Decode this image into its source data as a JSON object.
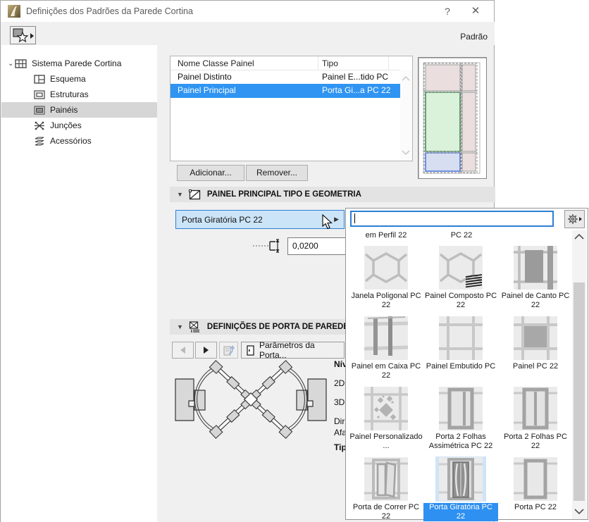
{
  "window": {
    "title": "Definições dos Padrões da Parede Cortina",
    "help": "?",
    "close": "✕"
  },
  "toolbar": {
    "preset_label": "Padrão",
    "favorites_icon": "square-star-flyout-icon"
  },
  "sidebar": {
    "items": [
      {
        "label": "Sistema Parede Cortina",
        "icon": "curtain-wall-system-icon",
        "level": 0,
        "expanded": true,
        "selected": false
      },
      {
        "label": "Esquema",
        "icon": "scheme-icon",
        "level": 1,
        "selected": false
      },
      {
        "label": "Estruturas",
        "icon": "frames-icon",
        "level": 1,
        "selected": false
      },
      {
        "label": "Painéis",
        "icon": "panel-icon",
        "level": 1,
        "selected": true
      },
      {
        "label": "Junções",
        "icon": "junction-icon",
        "level": 1,
        "selected": false
      },
      {
        "label": "Acessórios",
        "icon": "accessories-icon",
        "level": 1,
        "selected": false
      }
    ]
  },
  "panel_table": {
    "columns": [
      "Nome Classe Painel",
      "Tipo"
    ],
    "rows": [
      {
        "name": "Painel Distinto",
        "type": "Painel E...tido PC",
        "selected": false
      },
      {
        "name": "Painel Principal",
        "type": "Porta Gi...a PC 22",
        "selected": true
      }
    ],
    "add_label": "Adicionar...",
    "remove_label": "Remover..."
  },
  "section1": {
    "title": "PAINEL PRINCIPAL TIPO E GEOMETRIA"
  },
  "type_dropdown": {
    "value": "Porta Giratória PC 22"
  },
  "thickness": {
    "value": "0,0200",
    "icon": "panel-thickness-icon"
  },
  "section2": {
    "title": "DEFINIÇÕES DE PORTA DE PAREDE CO"
  },
  "door_toolbar": {
    "back_icon": "arrow-left-icon",
    "forward_icon": "arrow-right-icon",
    "transfer_icon": "transfer-settings-icon",
    "params_label": "Parâmetros da Porta..."
  },
  "door_params": {
    "labels": [
      {
        "text": "Nív",
        "bold": true
      },
      {
        "text": "2D",
        "bold": false
      },
      {
        "text": "3D",
        "bold": false
      },
      {
        "text": "Dir",
        "bold": false
      },
      {
        "text": "Afa",
        "bold": false
      },
      {
        "text": "Tip",
        "bold": true
      }
    ]
  },
  "popup": {
    "search_value": "",
    "gear_icon": "gear-flyout-icon",
    "partial_labels": [
      "em Perfil 22",
      "PC 22"
    ],
    "items": [
      {
        "label": "Janela Poligonal PC 22",
        "icon": "hex",
        "selected": false
      },
      {
        "label": "Painel Composto PC 22",
        "icon": "hex-hatch",
        "selected": false
      },
      {
        "label": "Painel de Canto PC 22",
        "icon": "corner",
        "selected": false
      },
      {
        "label": "Painel em Caixa PC 22",
        "icon": "box",
        "selected": false
      },
      {
        "label": "Painel Embutido PC",
        "icon": "grid",
        "selected": false
      },
      {
        "label": "Painel PC 22",
        "icon": "grid-fill",
        "selected": false
      },
      {
        "label": "Painel Personalizado ...",
        "icon": "diamonds",
        "selected": false
      },
      {
        "label": "Porta 2 Folhas Assimétrica PC 22",
        "icon": "door2a",
        "selected": false
      },
      {
        "label": "Porta 2 Folhas PC 22",
        "icon": "door2",
        "selected": false
      },
      {
        "label": "Porta de Correr PC 22",
        "icon": "door-slide",
        "selected": false
      },
      {
        "label": "Porta Giratória PC 22",
        "icon": "door-rev",
        "selected": true
      },
      {
        "label": "Porta PC 22",
        "icon": "door1",
        "selected": false
      }
    ]
  },
  "colors": {
    "selection_blue": "#3095f2",
    "selection_light_blue": "#cfe4f7",
    "focus_border_blue": "#2d7fd4",
    "dialog_bg": "#f0f0f0",
    "section_header_bg": "#e3e3e3",
    "preview_cell_pink": "#eadede",
    "preview_cell_green": "#daf1da",
    "preview_cell_blue": "#d7def1"
  }
}
